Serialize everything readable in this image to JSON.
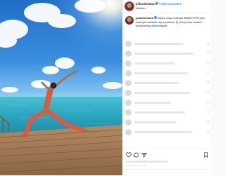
{
  "header": {
    "username": "juliawieniawa",
    "separator": "•",
    "follow_label": "Obserwowanie",
    "location": "Maldives"
  },
  "caption": {
    "username": "juliawieniawa",
    "line1": "Nasza nowa kolekcja INNER FIRE jest",
    "line2": "sesji zdjęciowej, co",
    "line3": "kolekcja i świetnie się sprawdza 🔥 Który kolor wolicie?",
    "line4": "#fireboost kiedy ruch zdjęć",
    "line5": "Rzeczy wpisywane",
    "hashtags": "#mylinedrop #lamourtgirls"
  },
  "comments": {
    "count_rows": 7
  },
  "icons": [
    "heart-icon",
    "comment-icon",
    "share-icon",
    "bookmark-icon"
  ],
  "colors": {
    "accent": "#3897f0",
    "story_ring": "#e1306c",
    "suit": "#e8553a"
  }
}
